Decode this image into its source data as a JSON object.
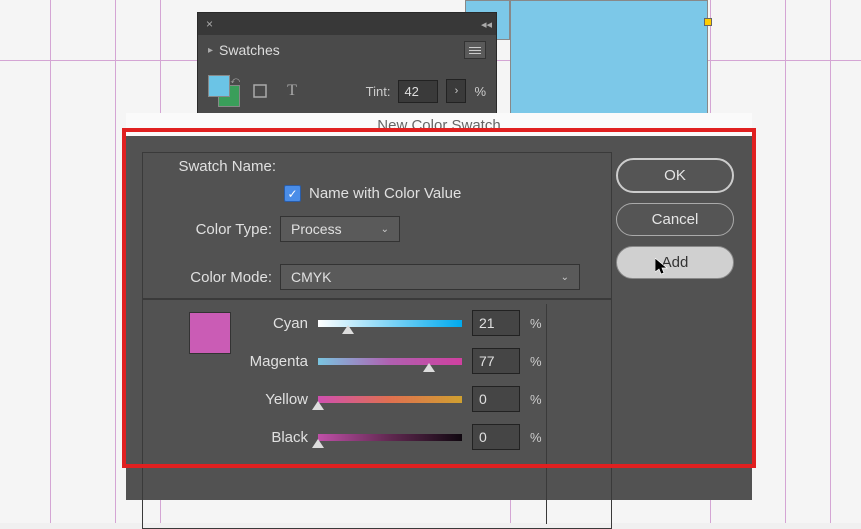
{
  "swatches_panel": {
    "title": "Swatches",
    "tint_label": "Tint:",
    "tint_value": "42",
    "percent": "%"
  },
  "dialog": {
    "title": "New Color Swatch",
    "swatch_name_label": "Swatch Name:",
    "name_with_color_label": "Name with Color Value",
    "color_type_label": "Color Type:",
    "color_type_value": "Process",
    "color_mode_label": "Color Mode:",
    "color_mode_value": "CMYK",
    "sliders": {
      "cyan_label": "Cyan",
      "cyan_value": "21",
      "magenta_label": "Magenta",
      "magenta_value": "77",
      "yellow_label": "Yellow",
      "yellow_value": "0",
      "black_label": "Black",
      "black_value": "0",
      "percent": "%"
    },
    "buttons": {
      "ok": "OK",
      "cancel": "Cancel",
      "add": "Add"
    },
    "result_color": "#ca5cb5"
  }
}
